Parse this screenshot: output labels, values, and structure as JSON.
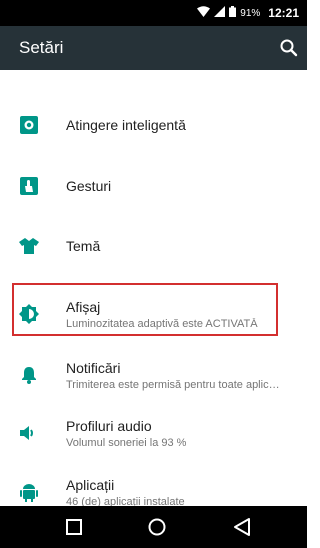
{
  "status_bar": {
    "battery": "91%",
    "time": "12:21"
  },
  "app_bar": {
    "title": "Setări",
    "search_icon": "search-icon"
  },
  "settings": [
    {
      "title": "Atingere inteligentă",
      "summary": "",
      "icon": "smart-touch-icon"
    },
    {
      "title": "Gesturi",
      "summary": "",
      "icon": "gesture-icon"
    },
    {
      "title": "Temă",
      "summary": "",
      "icon": "shirt-icon"
    },
    {
      "title": "Afișaj",
      "summary": "Luminozitatea adaptivă este ACTIVATĂ",
      "icon": "brightness-icon"
    },
    {
      "title": "Notificări",
      "summary": "Trimiterea este permisă pentru toate aplic…",
      "icon": "bell-icon"
    },
    {
      "title": "Profiluri audio",
      "summary": "Volumul soneriei la 93 %",
      "icon": "volume-icon"
    },
    {
      "title": "Aplicații",
      "summary": "46 (de) aplicații instalate",
      "icon": "android-icon"
    }
  ],
  "nav_bar": {
    "buttons": [
      "recents-button",
      "home-button",
      "back-button"
    ]
  },
  "colors": {
    "app_bar": "#263238",
    "accent": "#009688",
    "highlight": "#d32f2f"
  }
}
